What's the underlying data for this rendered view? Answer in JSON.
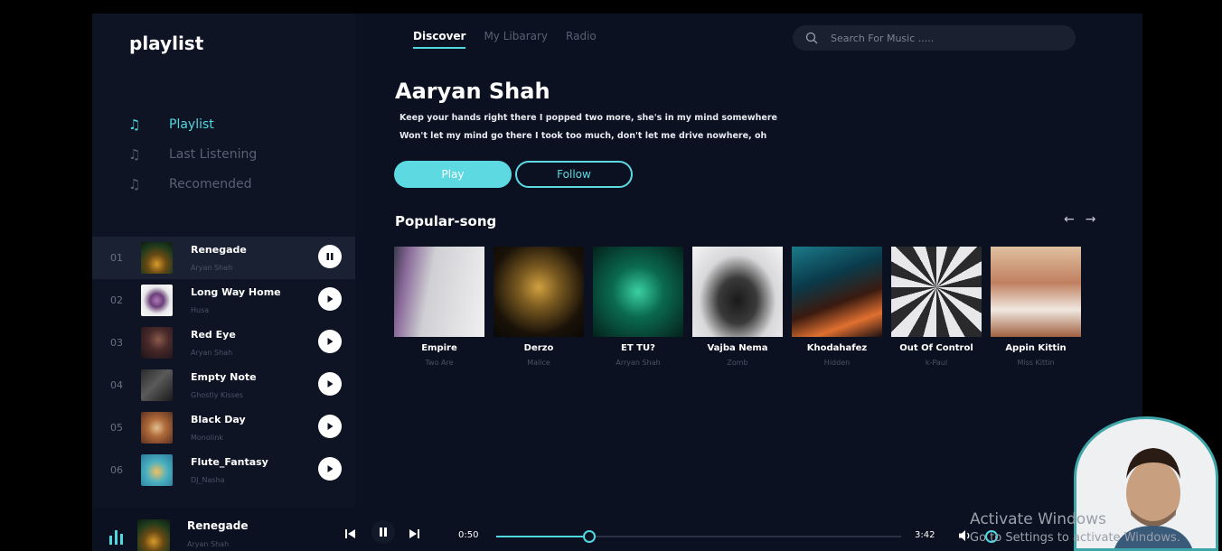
{
  "app": {
    "title": "playlist"
  },
  "nav": [
    {
      "label": "Playlist",
      "active": true
    },
    {
      "label": "Last Listening",
      "active": false
    },
    {
      "label": "Recomended",
      "active": false
    }
  ],
  "tracks": [
    {
      "num": "01",
      "name": "Renegade",
      "artist": "Aryan Shah",
      "playing": true
    },
    {
      "num": "02",
      "name": "Long Way Home",
      "artist": "Husa",
      "playing": false
    },
    {
      "num": "03",
      "name": "Red Eye",
      "artist": "Aryan Shah",
      "playing": false
    },
    {
      "num": "04",
      "name": "Empty Note",
      "artist": "Ghostly Kisses",
      "playing": false
    },
    {
      "num": "05",
      "name": "Black Day",
      "artist": "Monolink",
      "playing": false
    },
    {
      "num": "06",
      "name": "Flute_Fantasy",
      "artist": "DJ_Nasha",
      "playing": false
    }
  ],
  "tabs": [
    "Discover",
    "My Libarary",
    "Radio"
  ],
  "search": {
    "placeholder": "Search For Music ....."
  },
  "hero": {
    "artist": "Aaryan Shah",
    "lyric1": "Keep your hands right there I popped two more, she's in my mind somewhere",
    "lyric2": "Won't let my mind go there I took too much, don't let me drive nowhere, oh",
    "play_label": "Play",
    "follow_label": "Follow"
  },
  "popular": {
    "title": "Popular-song",
    "items": [
      {
        "title": "Empire",
        "artist": "Two Are"
      },
      {
        "title": "Derzo",
        "artist": "Malice"
      },
      {
        "title": "ET TU?",
        "artist": "Arryan Shah"
      },
      {
        "title": "Vajba Nema",
        "artist": "Zomb"
      },
      {
        "title": "Khodahafez",
        "artist": "Hidden"
      },
      {
        "title": "Out Of Control",
        "artist": "k-Paul"
      },
      {
        "title": "Appin Kittin",
        "artist": "Miss Kittin"
      }
    ]
  },
  "player": {
    "title": "Renegade",
    "artist": "Aryan Shah",
    "current": "0:50",
    "duration": "3:42",
    "progress": 0.23,
    "accent": "#4fd8e0"
  },
  "watermark": {
    "line1": "Activate Windows",
    "line2": "Go to Settings to activate Windows."
  }
}
